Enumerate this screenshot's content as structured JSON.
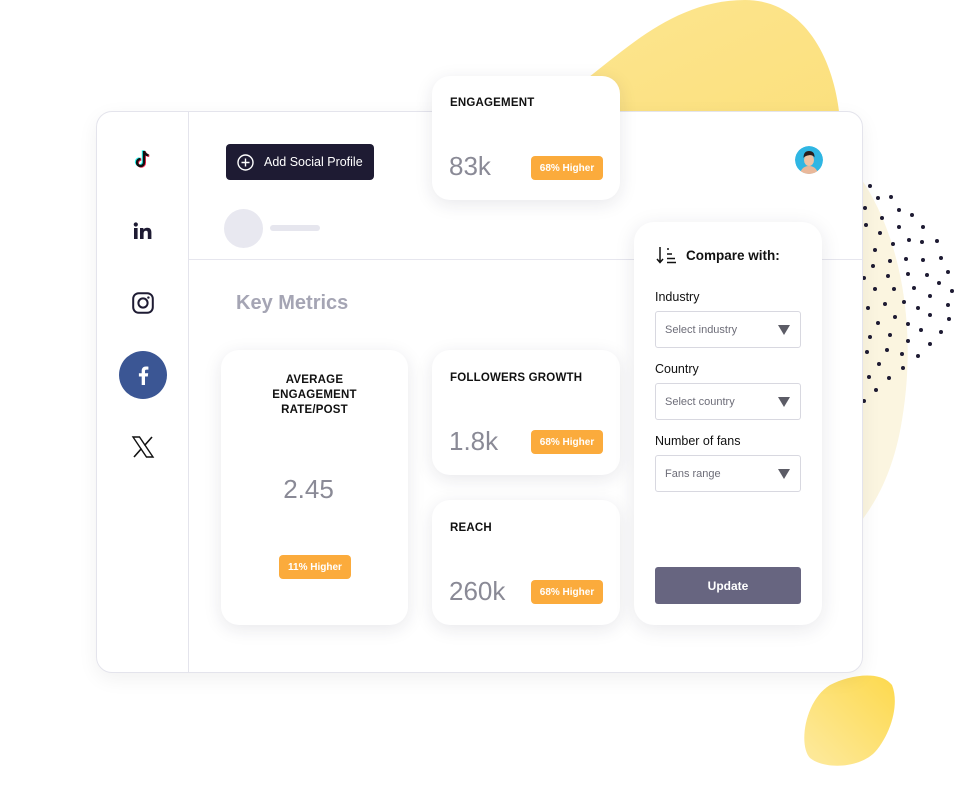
{
  "header": {
    "add_profile_label": "Add Social Profile",
    "user_avatar": "user-avatar-photo"
  },
  "sidebar": {
    "items": [
      {
        "name": "TikTok",
        "icon": "tiktok-icon",
        "active": false
      },
      {
        "name": "LinkedIn",
        "icon": "linkedin-icon",
        "active": false
      },
      {
        "name": "Instagram",
        "icon": "instagram-icon",
        "active": false
      },
      {
        "name": "Facebook",
        "icon": "facebook-icon",
        "active": true
      },
      {
        "name": "X",
        "icon": "x-icon",
        "active": false
      }
    ]
  },
  "main": {
    "section_title": "Key Metrics",
    "metrics": {
      "engagement": {
        "title": "ENGAGEMENT",
        "value": "83k",
        "badge": "68% Higher"
      },
      "avg_engagement": {
        "title": "AVERAGE ENGAGEMENT RATE/POST",
        "value": "2.45",
        "badge": "11% Higher"
      },
      "followers_growth": {
        "title": "FOLLOWERS GROWTH",
        "value": "1.8k",
        "badge": "68% Higher"
      },
      "reach": {
        "title": "REACH",
        "value": "260k",
        "badge": "68% Higher"
      }
    }
  },
  "compare": {
    "title": "Compare with:",
    "industry": {
      "label": "Industry",
      "placeholder": "Select industry"
    },
    "country": {
      "label": "Country",
      "placeholder": "Select country"
    },
    "fans": {
      "label": "Number of fans",
      "placeholder": "Fans range"
    },
    "update_label": "Update"
  },
  "colors": {
    "badge": "#fbab3c",
    "primary_button": "#1e1b33",
    "update_button": "#676580",
    "facebook_active": "#3b5694",
    "accent_blob": "#fde58f"
  }
}
